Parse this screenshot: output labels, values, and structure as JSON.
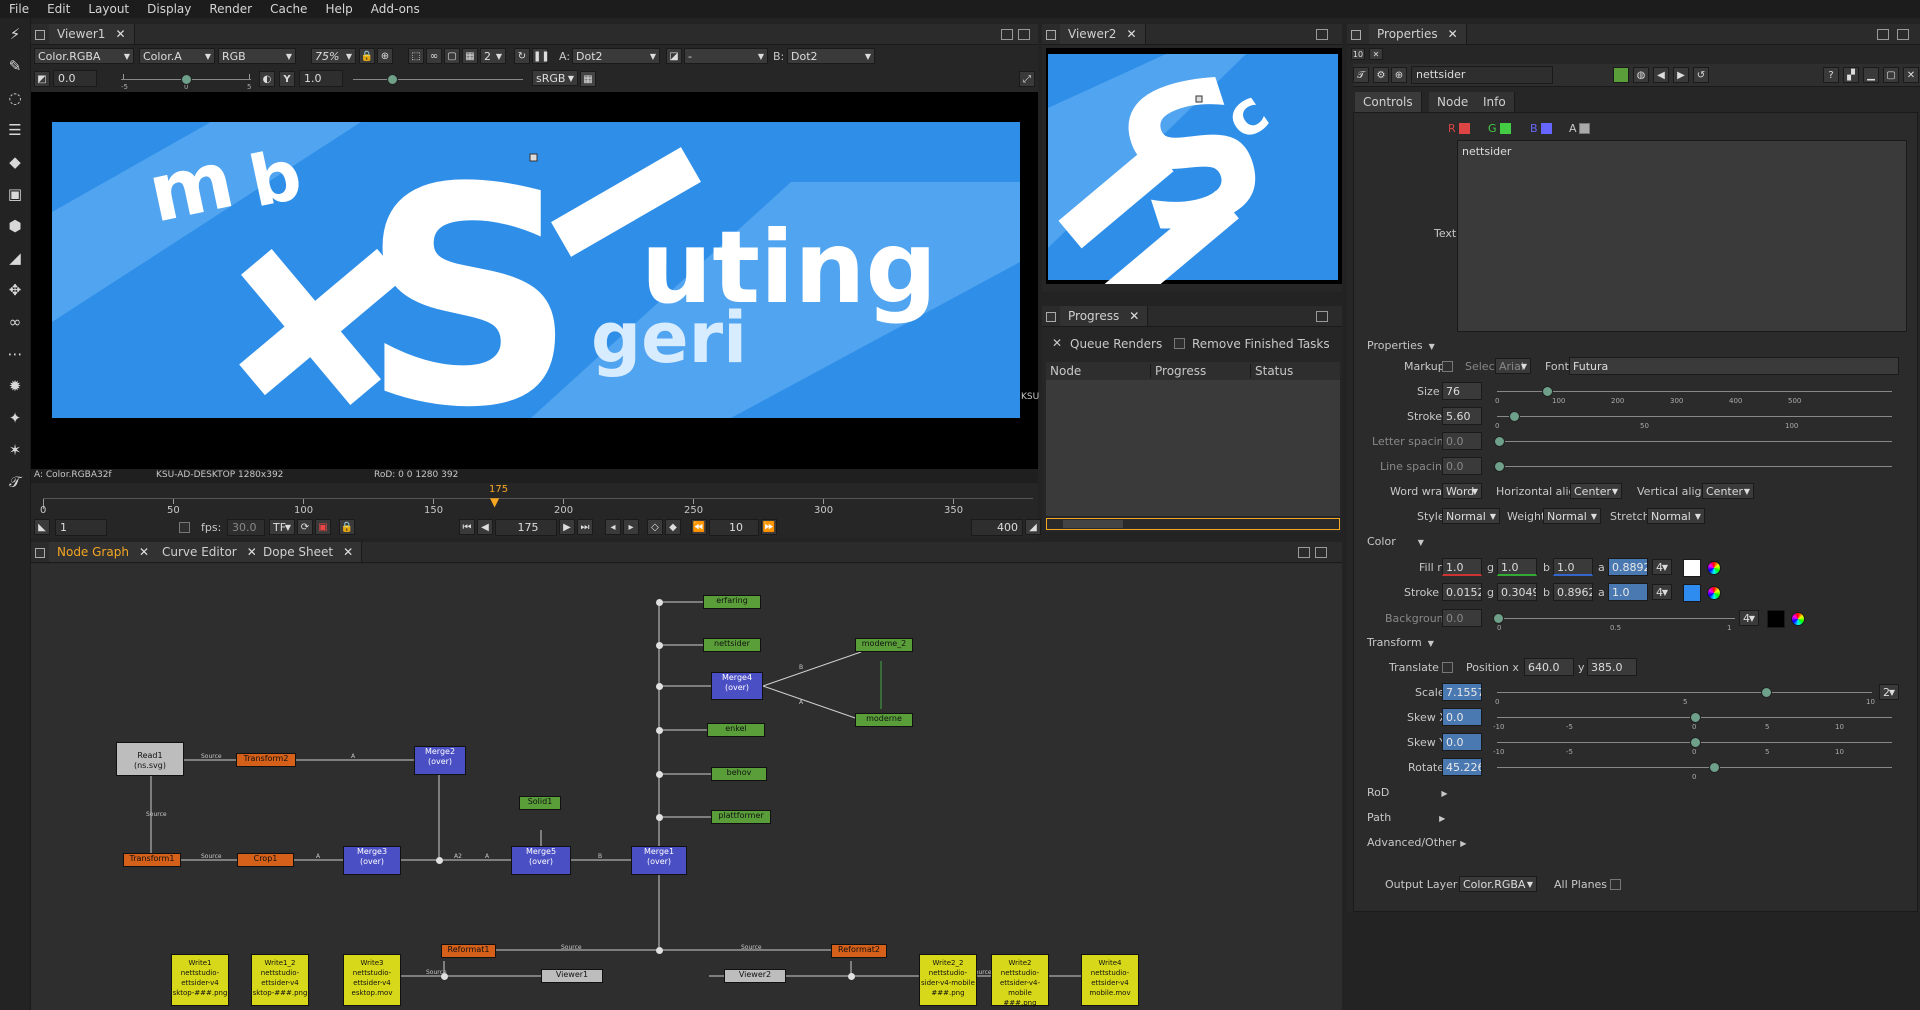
{
  "menu": [
    "File",
    "Edit",
    "Layout",
    "Display",
    "Render",
    "Cache",
    "Help",
    "Add-ons"
  ],
  "viewer1": {
    "tab": "Viewer1",
    "channels": "Color.RGBA",
    "alpha": "Color.A",
    "display": "RGB",
    "zoom": "75%",
    "proxy": "2",
    "input_a_label": "A:",
    "input_a": "Dot2",
    "operation": "-",
    "input_b_label": "B:",
    "input_b": "Dot2",
    "gain": "0.0",
    "gamma": "1.0",
    "colorspace": "sRGB",
    "gain_ticks": [
      "-5",
      "0",
      "5"
    ],
    "info_left": "A: Color.RGBA32f",
    "info_mid": "KSU-AD-DESKTOP 1280x392",
    "info_right": "RoD: 0 0 1280 392",
    "corner_label": "KSU",
    "image_text_main": "uting",
    "image_text_sub": "geri"
  },
  "timeline": {
    "current_frame_marker": "175",
    "ticks": [
      "0",
      "50",
      "100",
      "150",
      "200",
      "250",
      "300",
      "350"
    ],
    "start": "1",
    "fps_label": "fps:",
    "fps": "30.0",
    "tf": "TF",
    "frame": "175",
    "step": "10",
    "end": "400"
  },
  "viewer2": {
    "tab": "Viewer2"
  },
  "progress": {
    "tab": "Progress",
    "queue_label": "Queue Renders",
    "remove_label": "Remove Finished Tasks",
    "columns": [
      "Node",
      "Progress",
      "Status"
    ]
  },
  "nodegraph": {
    "tabs": [
      "Node Graph",
      "Curve Editor",
      "Dope Sheet"
    ],
    "nodes": [
      {
        "name": "erfaring",
        "kind": "text"
      },
      {
        "name": "nettsider",
        "kind": "text"
      },
      {
        "name": "modeme_2",
        "kind": "text"
      },
      {
        "name": "Merge4\n(over)",
        "kind": "merge"
      },
      {
        "name": "moderne",
        "kind": "text"
      },
      {
        "name": "enkel",
        "kind": "text"
      },
      {
        "name": "Read1\n(ns.svg)",
        "kind": "read"
      },
      {
        "name": "Transform2",
        "kind": "transform"
      },
      {
        "name": "Merge2\n(over)",
        "kind": "merge"
      },
      {
        "name": "behov",
        "kind": "text"
      },
      {
        "name": "Solid1",
        "kind": "solid"
      },
      {
        "name": "plattformer",
        "kind": "text"
      },
      {
        "name": "Transform1",
        "kind": "transform"
      },
      {
        "name": "Crop1",
        "kind": "transform"
      },
      {
        "name": "Merge3\n(over)",
        "kind": "merge"
      },
      {
        "name": "Merge5\n(over)",
        "kind": "merge"
      },
      {
        "name": "Merge1\n(over)",
        "kind": "merge"
      },
      {
        "name": "Reformat1",
        "kind": "transform"
      },
      {
        "name": "Reformat2",
        "kind": "transform"
      },
      {
        "name": "Viewer1",
        "kind": "viewer"
      },
      {
        "name": "Viewer2",
        "kind": "viewer"
      },
      {
        "name": "Write1\nnettstudio-\nettsider-v4\nsktop-###.png",
        "kind": "write"
      },
      {
        "name": "Write1_2\nnettstudio-\nettsider-v4\nsktop-###.png",
        "kind": "write"
      },
      {
        "name": "Write3\nnettstudio-\nettsider-v4\nesktop.mov",
        "kind": "write"
      },
      {
        "name": "Write2_2\nnettstudio-\nsider-v4-mobile\n###.png",
        "kind": "write"
      },
      {
        "name": "Write2\nnettstudio-\nettsider-v4-mobile\n###.png",
        "kind": "write"
      },
      {
        "name": "Write4\nnettstudio-\nettsider-v4\nmobile.mov",
        "kind": "write"
      }
    ],
    "edge_labels": [
      "Source",
      "A",
      "Source",
      "Source",
      "A",
      "A2",
      "A",
      "B",
      "B",
      "A",
      "Source",
      "Source",
      "Source",
      "Source"
    ]
  },
  "properties": {
    "tab": "Properties",
    "node_name": "nettsider",
    "subtabs": [
      "Controls",
      "Node",
      "Info"
    ],
    "channels": [
      "R",
      "G",
      "B",
      "A"
    ],
    "text_label": "Text",
    "text_value": "nettsider",
    "group_properties": "Properties",
    "markup_label": "Markup",
    "select_label": "Select",
    "select_value": "Arial",
    "font_label": "Font",
    "font_value": "Futura",
    "size_label": "Size",
    "size": "76",
    "size_ticks": [
      "0",
      "100",
      "200",
      "300",
      "400",
      "500"
    ],
    "stroke_label": "Stroke",
    "stroke": "5.60",
    "stroke_ticks": [
      "0",
      "50",
      "100"
    ],
    "letter_spacing_label": "Letter spacing",
    "letter_spacing": "0.0",
    "line_spacing_label": "Line spacing",
    "line_spacing": "0.0",
    "word_wrap_label": "Word wrap",
    "word_wrap": "Word",
    "h_align_label": "Horizontal align",
    "h_align": "Center",
    "v_align_label": "Vertical align",
    "v_align": "Center",
    "style_label": "Style",
    "style": "Normal",
    "weight_label": "Weight",
    "weight": "Normal",
    "stretch_label": "Stretch",
    "stretch": "Normal",
    "group_color": "Color",
    "fill_label": "Fill r",
    "fill": {
      "r": "1.0",
      "g": "1.0",
      "b": "1.0",
      "a": "0.88920"
    },
    "stroke_color_label": "Stroke r",
    "stroke_color": {
      "r": "0.01520",
      "g": "0.30498",
      "b": "0.89626",
      "a": "1.0"
    },
    "dims": "4",
    "background_label": "Background",
    "background": "0.0",
    "background_ticks": [
      "0",
      "0.5",
      "1"
    ],
    "group_transform": "Transform",
    "translate_label": "Translate",
    "position_label": "Position x",
    "position_x": "640.0",
    "position_y_label": "y",
    "position_y": "385.0",
    "scale_label": "Scale",
    "scale": "7.15577",
    "scale_ticks": [
      "0",
      "5",
      "10"
    ],
    "scale_dims": "2",
    "skewx_label": "Skew X",
    "skewx": "0.0",
    "skewy_label": "Skew Y",
    "skewy": "0.0",
    "skew_ticks": [
      "-10",
      "-5",
      "0",
      "5",
      "10"
    ],
    "rotate_label": "Rotate",
    "rotate": "45.2261",
    "rotate_ticks": [
      "0"
    ],
    "rod_label": "RoD",
    "path_label": "Path",
    "advanced_label": "Advanced/Other",
    "output_layer_label": "Output Layer",
    "output_layer": "Color.RGBA",
    "all_planes_label": "All Planes",
    "g_label": "g",
    "b_label": "b",
    "a_label": "a"
  },
  "colors": {
    "accent": "#f5a623",
    "viewer_blue": "#2f8fe8",
    "text_node": "#5a9e3a",
    "merge_node": "#4a4fc4",
    "transform_node": "#d4601a",
    "write_node": "#d8d81a"
  }
}
